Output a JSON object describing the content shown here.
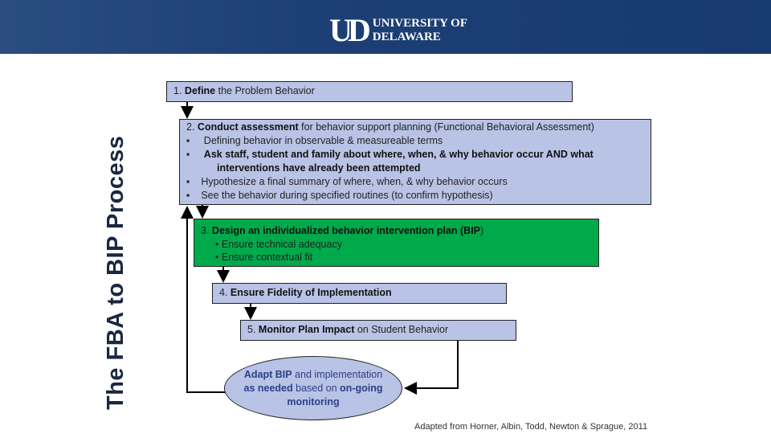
{
  "header": {
    "logo_mark": "UD",
    "logo_line1": "UNIVERSITY OF",
    "logo_line2": "DELAWARE"
  },
  "title": "The FBA to BIP Process",
  "steps": [
    {
      "num": "1.",
      "bold": "Define",
      "rest": " the Problem Behavior"
    },
    {
      "num": "2.",
      "bold": "Conduct assessment",
      "rest": " for behavior support planning (Functional Behavioral Assessment)",
      "bullets": [
        {
          "text": "Defining behavior in observable & measureable terms",
          "bold": false
        },
        {
          "text": "Ask staff, student and family about where, when, & why behavior occur AND what interventions have already been attempted",
          "bold": true
        },
        {
          "text": "Hypothesize a final summary of where, when, & why behavior occurs",
          "bold": false
        },
        {
          "text": "See the behavior during specified routines (to confirm hypothesis)",
          "bold": false
        }
      ]
    },
    {
      "num": "3.",
      "bold": "Design an individualized behavior intervention plan (BIP",
      "rest": ")",
      "bullets": [
        "Ensure technical adequacy",
        "Ensure contextual fit"
      ]
    },
    {
      "num": "4.",
      "bold": "Ensure Fidelity of Implementation",
      "rest": ""
    },
    {
      "num": "5.",
      "bold": "Monitor Plan Impact",
      "rest": " on Student Behavior"
    }
  ],
  "adapt": {
    "b1": "Adapt BIP",
    "t1": " and implementation ",
    "b2": "as needed",
    "t2": " based on ",
    "b3": "on-going monitoring"
  },
  "credit": "Adapted from Horner, Albin, Todd, Newton & Sprague, 2011",
  "colors": {
    "banner": "#1c3f75",
    "box": "#b9c3e6",
    "green": "#00aa4a"
  }
}
